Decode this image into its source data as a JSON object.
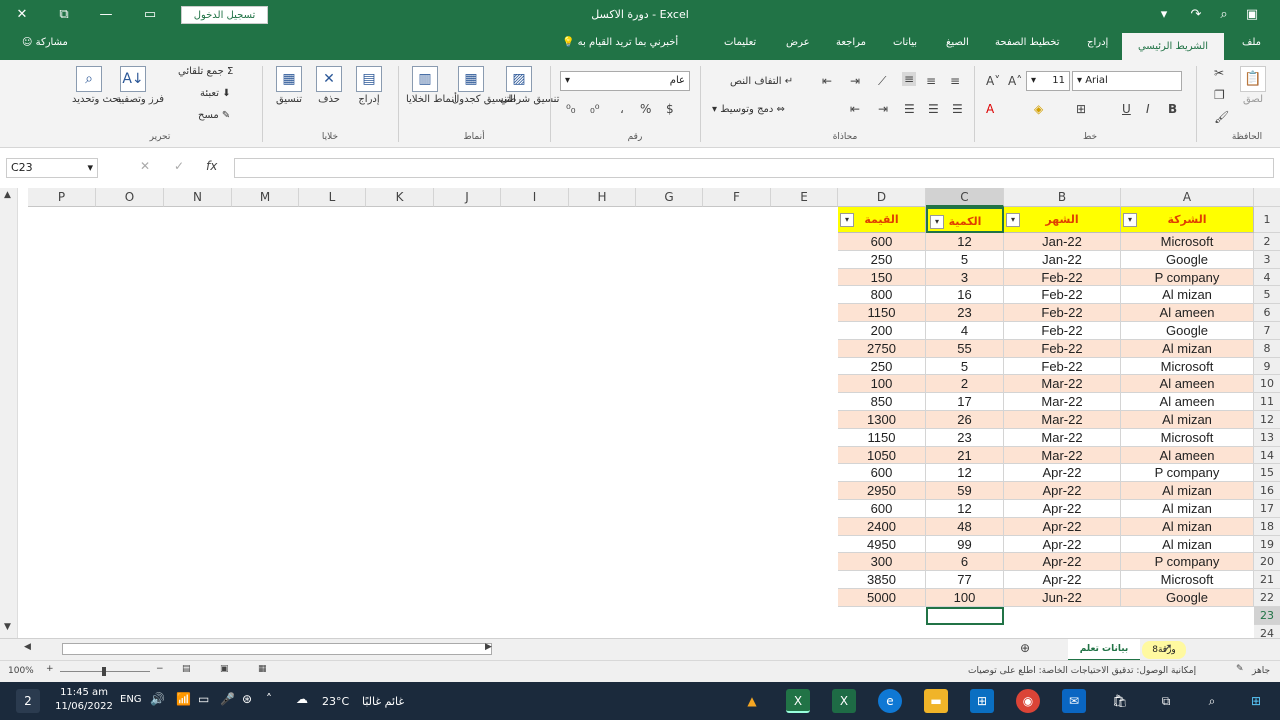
{
  "titlebar": {
    "title": "دورة الاكسل  -  Excel",
    "login_label": "تسجيل الدخول",
    "close_glyph": "✕",
    "restore_glyph": "⧉",
    "minimize_glyph": "—",
    "ribbon_toggle_glyph": "▭"
  },
  "tabs": {
    "file": "ملف",
    "home": "الشريط الرئيسي",
    "insert": "إدراج",
    "page_layout": "تخطيط الصفحة",
    "formulas": "الصيغ",
    "data": "بيانات",
    "review": "مراجعة",
    "view": "عرض",
    "help": "تعليمات",
    "tell_me": "أخبرني بما تريد القيام به",
    "share": "مشاركة"
  },
  "ribbon": {
    "clipboard": {
      "group": "الحافظة",
      "paste": "لصق"
    },
    "font": {
      "group": "خط",
      "name": "Arial",
      "size": "11",
      "bold": "B",
      "italic": "I",
      "underline": "U"
    },
    "alignment": {
      "group": "محاذاة",
      "wrap": "التفاف النص",
      "merge": "دمج وتوسيط"
    },
    "number": {
      "group": "رقم",
      "format": "عام",
      "percent": "%",
      "comma": "،"
    },
    "styles": {
      "group": "أنماط",
      "conditional": "تنسيق شرطي",
      "as_table": "التنسيق كجدول",
      "cell_styles": "أنماط الخلايا"
    },
    "cells": {
      "group": "خلايا",
      "insert": "إدراج",
      "delete": "حذف",
      "format": "تنسيق"
    },
    "editing": {
      "group": "تحرير",
      "autosum": "جمع تلقائي",
      "fill": "تعبئة",
      "clear": "مسح",
      "sort": "فرز وتصفية",
      "find": "بحث وتحديد"
    }
  },
  "formula_bar": {
    "name_box": "C23",
    "fx": "fx",
    "value": ""
  },
  "columns": [
    "P",
    "O",
    "N",
    "M",
    "L",
    "K",
    "J",
    "I",
    "H",
    "G",
    "F",
    "E",
    "D",
    "C",
    "B",
    "A"
  ],
  "table": {
    "headers": [
      "الشركة",
      "الشهر",
      "الكمية",
      "القيمة"
    ],
    "rows": [
      [
        "Microsoft",
        "Jan-22",
        "12",
        "600"
      ],
      [
        "Google",
        "Jan-22",
        "5",
        "250"
      ],
      [
        "P company",
        "Feb-22",
        "3",
        "150"
      ],
      [
        "Al mizan",
        "Feb-22",
        "16",
        "800"
      ],
      [
        "Al ameen",
        "Feb-22",
        "23",
        "1150"
      ],
      [
        "Google",
        "Feb-22",
        "4",
        "200"
      ],
      [
        "Al mizan",
        "Feb-22",
        "55",
        "2750"
      ],
      [
        "Microsoft",
        "Feb-22",
        "5",
        "250"
      ],
      [
        "Al ameen",
        "Mar-22",
        "2",
        "100"
      ],
      [
        "Al ameen",
        "Mar-22",
        "17",
        "850"
      ],
      [
        "Al mizan",
        "Mar-22",
        "26",
        "1300"
      ],
      [
        "Microsoft",
        "Mar-22",
        "23",
        "1150"
      ],
      [
        "Al ameen",
        "Mar-22",
        "21",
        "1050"
      ],
      [
        "P company",
        "Apr-22",
        "12",
        "600"
      ],
      [
        "Al mizan",
        "Apr-22",
        "59",
        "2950"
      ],
      [
        "Al mizan",
        "Apr-22",
        "12",
        "600"
      ],
      [
        "Al mizan",
        "Apr-22",
        "48",
        "2400"
      ],
      [
        "Al mizan",
        "Apr-22",
        "99",
        "4950"
      ],
      [
        "P company",
        "Apr-22",
        "6",
        "300"
      ],
      [
        "Microsoft",
        "Apr-22",
        "77",
        "3850"
      ],
      [
        "Google",
        "Jun-22",
        "100",
        "5000"
      ]
    ],
    "row_numbers": [
      "1",
      "2",
      "3",
      "4",
      "5",
      "6",
      "7",
      "8",
      "9",
      "10",
      "11",
      "12",
      "13",
      "14",
      "15",
      "16",
      "17",
      "18",
      "19",
      "20",
      "21",
      "22",
      "23",
      "24"
    ],
    "header_fill": "#ffff00",
    "header_text_color": "#e04000",
    "band_color": "#fde3d3"
  },
  "sheets": {
    "tab1": "بيانات تعلم",
    "tab2": "ورقة8"
  },
  "status": {
    "ready": "جاهز",
    "accessibility": "إمكانية الوصول: تدقيق الاحتياجات الخاصة: اطلع على توصيات",
    "zoom": "100%"
  },
  "taskbar": {
    "time": "11:45 am",
    "date": "11/06/2022",
    "lang": "ENG",
    "temp": "23°C",
    "weather": "غائم غالبًا",
    "notif": "2"
  },
  "colors": {
    "excel_green": "#217346",
    "taskbar": "#1b2a3c"
  }
}
